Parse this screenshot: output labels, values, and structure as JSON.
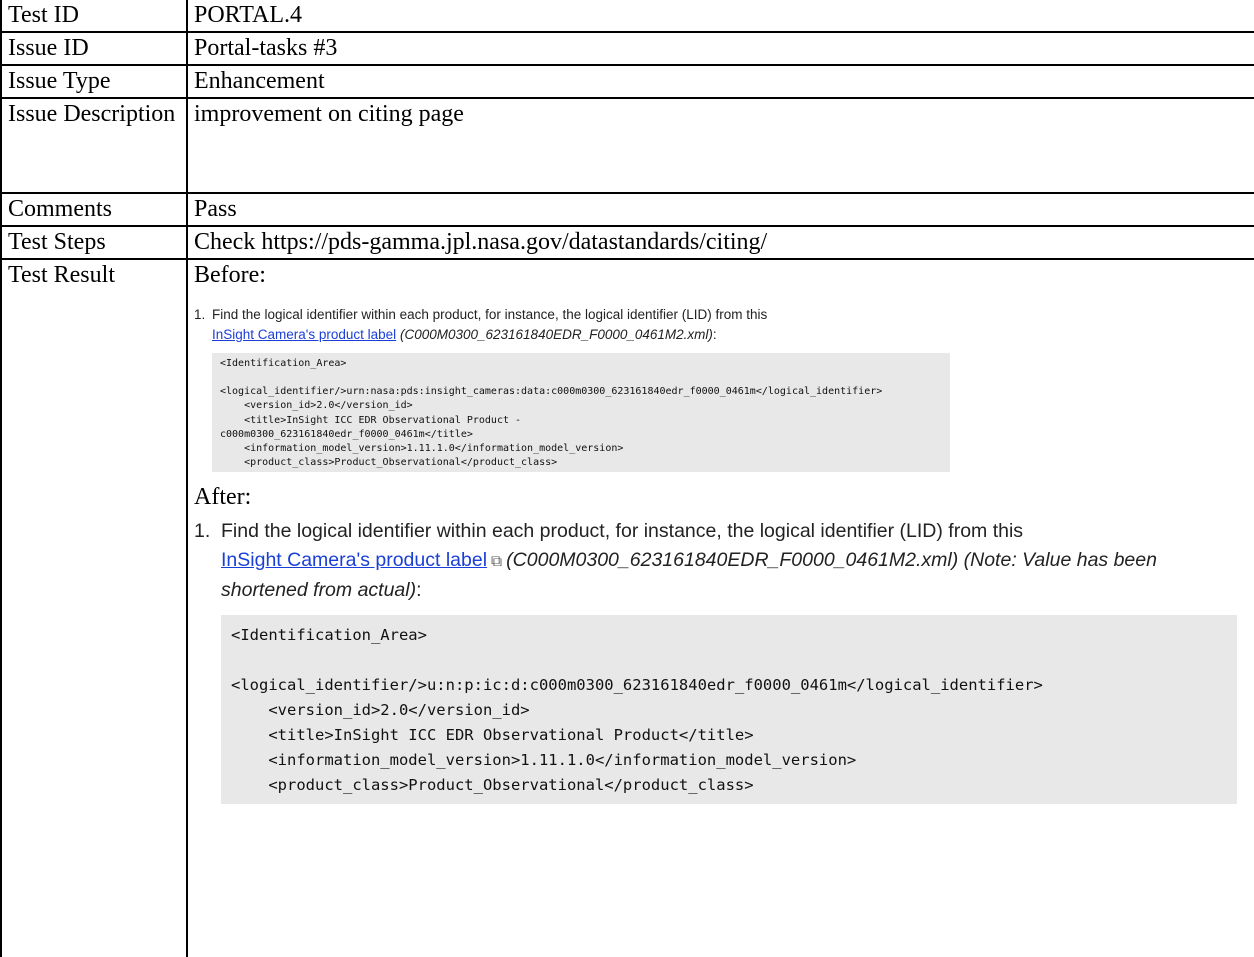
{
  "rows": [
    {
      "label": "Test ID",
      "value": "PORTAL.4"
    },
    {
      "label": "Issue ID",
      "value": "Portal-tasks #3"
    },
    {
      "label": "Issue Type",
      "value": "Enhancement"
    },
    {
      "label": "Issue Description",
      "value": "improvement on citing page"
    },
    {
      "label": "Comments",
      "value": "Pass"
    },
    {
      "label": "Test Steps",
      "value": "Check https://pds-gamma.jpl.nasa.gov/datastandards/citing/"
    },
    {
      "label": "Test Result"
    }
  ],
  "result": {
    "before_label": "Before:",
    "after_label": "After:",
    "before": {
      "number": "1.",
      "text_1": "Find the logical identifier within each product, for instance, the logical identifier (LID) from this",
      "link": "InSight Camera's product label",
      "italic": "(C000M0300_623161840EDR_F0000_0461M2.xml)",
      "tail": ":",
      "code": {
        "line_1": "<Identification_Area>",
        "line_2": "<logical_identifier/>urn:nasa:pds:insight_cameras:data:c000m0300_623161840edr_f0000_0461m</logical_identifier>",
        "line_3": "    <version_id>2.0</version_id>",
        "line_4": "    <title>InSight ICC EDR Observational Product -",
        "line_5": "c000m0300_623161840edr_f0000_0461m</title>",
        "line_6": "    <information_model_version>1.11.1.0</information_model_version>",
        "line_7": "    <product_class>Product_Observational</product_class>"
      }
    },
    "after": {
      "number": "1.",
      "text_1": "Find the logical identifier within each product, for instance, the logical identifier (LID) from this",
      "link": "InSight Camera's product label",
      "external_icon": "external-link-icon",
      "italic": "(C000M0300_623161840EDR_F0000_0461M2.xml) (Note: Value has been shortened from actual)",
      "tail": ":",
      "code": {
        "line_1": "<Identification_Area>",
        "line_2": "<logical_identifier/>u:n:p:ic:d:c000m0300_623161840edr_f0000_0461m</logical_identifier>",
        "line_3": "    <version_id>2.0</version_id>",
        "line_4": "    <title>InSight ICC EDR Observational Product</title>",
        "line_5": "    <information_model_version>1.11.1.0</information_model_version>",
        "line_6": "    <product_class>Product_Observational</product_class>"
      }
    }
  },
  "colors": {
    "link": "#1a3fd8",
    "code_bg": "#e8e8e8",
    "border": "#000000"
  }
}
